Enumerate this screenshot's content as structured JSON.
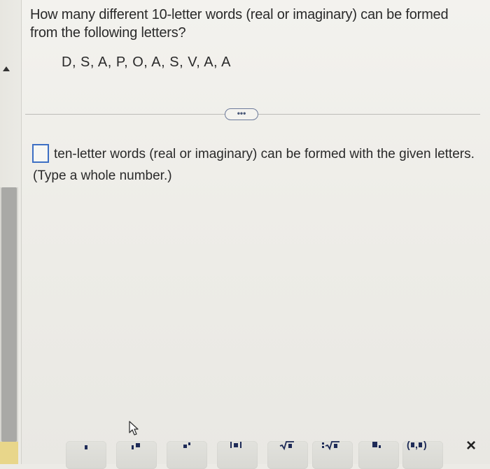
{
  "question": {
    "text": "How many different 10-letter words (real or imaginary) can be formed from the following letters?",
    "letters": "D, S, A, P, O, A, S, V, A, A"
  },
  "more_button": {
    "label": "•••"
  },
  "answer": {
    "value": "",
    "suffix": "ten-letter words (real or imaginary) can be formed with the given letters.",
    "hint": "(Type a whole number.)"
  },
  "toolbar": {
    "tools": [
      {
        "name": "fraction-tool-icon"
      },
      {
        "name": "mixed-number-tool-icon"
      },
      {
        "name": "exponent-tool-icon"
      },
      {
        "name": "absolute-value-tool-icon"
      },
      {
        "name": "square-root-tool-icon"
      },
      {
        "name": "nth-root-tool-icon"
      },
      {
        "name": "subscript-tool-icon"
      },
      {
        "name": "ordered-pair-tool-icon",
        "label": "(■,■)"
      }
    ],
    "close_label": "×"
  },
  "colors": {
    "answer_box_border": "#3d6fc4",
    "more_button_border": "#6c7a9a",
    "scroll_thumb": "#a9a9a6"
  }
}
